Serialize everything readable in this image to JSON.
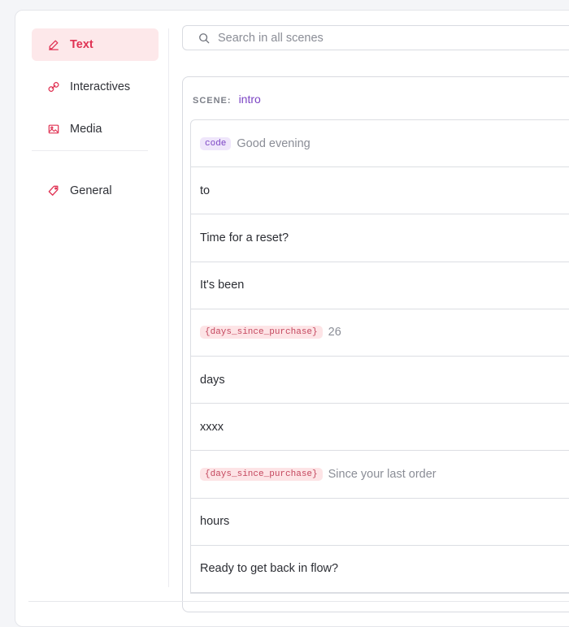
{
  "sidebar": {
    "items": [
      {
        "label": "Text",
        "icon": "pencil-icon",
        "active": true
      },
      {
        "label": "Interactives",
        "icon": "link-icon"
      },
      {
        "label": "Media",
        "icon": "image-icon"
      },
      {
        "label": "General",
        "icon": "tag-icon"
      }
    ]
  },
  "search": {
    "placeholder": "Search in all scenes",
    "value": ""
  },
  "scene": {
    "label": "SCENE:",
    "name": "intro"
  },
  "rows": [
    {
      "chip": "code",
      "text": "Good evening"
    },
    {
      "text": "to"
    },
    {
      "text": "Time for a reset?"
    },
    {
      "text": "It's been"
    },
    {
      "chip": "{days_since_purchase}",
      "text": "26"
    },
    {
      "text": "days"
    },
    {
      "text": "xxxx"
    },
    {
      "chip": "{days_since_purchase}",
      "text": "Since your last order"
    },
    {
      "text": "hours"
    },
    {
      "text": "Ready to get back in flow?"
    }
  ],
  "colors": {
    "accent": "#e03354",
    "accent_bg": "#fde8ea",
    "scene_name": "#7b44c4",
    "code_chip_bg": "#efe6fb",
    "var_chip_bg": "#fde4e6"
  }
}
